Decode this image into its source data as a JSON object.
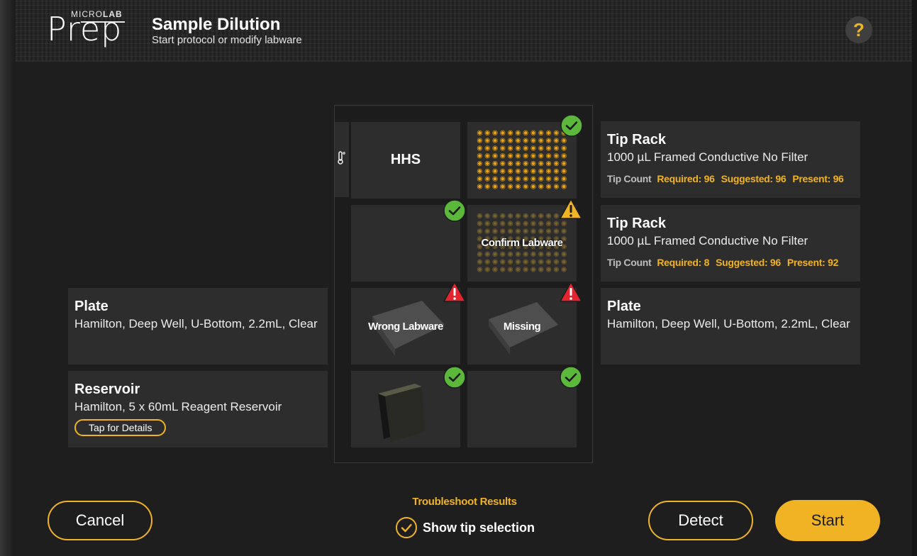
{
  "header": {
    "logo_micro": "MICRO",
    "logo_lab": "LAB",
    "logo_prep": "Prep",
    "title": "Sample Dilution",
    "subtitle": "Start protocol or modify labware",
    "help_label": "?"
  },
  "deck": {
    "hhs_label": "HHS",
    "confirm_label": "Confirm Labware",
    "wrong_label": "Wrong Labware",
    "missing_label": "Missing"
  },
  "cards": {
    "tip_rack_1": {
      "title": "Tip Rack",
      "desc": "1000 µL Framed Conductive No Filter",
      "tip_count_label": "Tip Count",
      "required": "Required: 96",
      "suggested": "Suggested: 96",
      "present": "Present: 96"
    },
    "tip_rack_2": {
      "title": "Tip Rack",
      "desc": "1000 µL Framed Conductive No Filter",
      "tip_count_label": "Tip Count",
      "required": "Required: 8",
      "suggested": "Suggested: 96",
      "present": "Present: 92"
    },
    "plate_right": {
      "title": "Plate",
      "desc": "Hamilton, Deep Well, U-Bottom, 2.2mL, Clear"
    },
    "plate_left": {
      "title": "Plate",
      "desc": "Hamilton, Deep Well, U-Bottom, 2.2mL, Clear"
    },
    "reservoir": {
      "title": "Reservoir",
      "desc": "Hamilton, 5 x 60mL Reagent Reservoir",
      "details_label": "Tap for Details"
    }
  },
  "footer": {
    "cancel_label": "Cancel",
    "troubleshoot_label": "Troubleshoot Results",
    "show_tip_label": "Show tip selection",
    "detect_label": "Detect",
    "start_label": "Start"
  },
  "colors": {
    "accent": "#f0b323",
    "success": "#5cb83a",
    "warning": "#f0b323",
    "error": "#e4252e"
  }
}
